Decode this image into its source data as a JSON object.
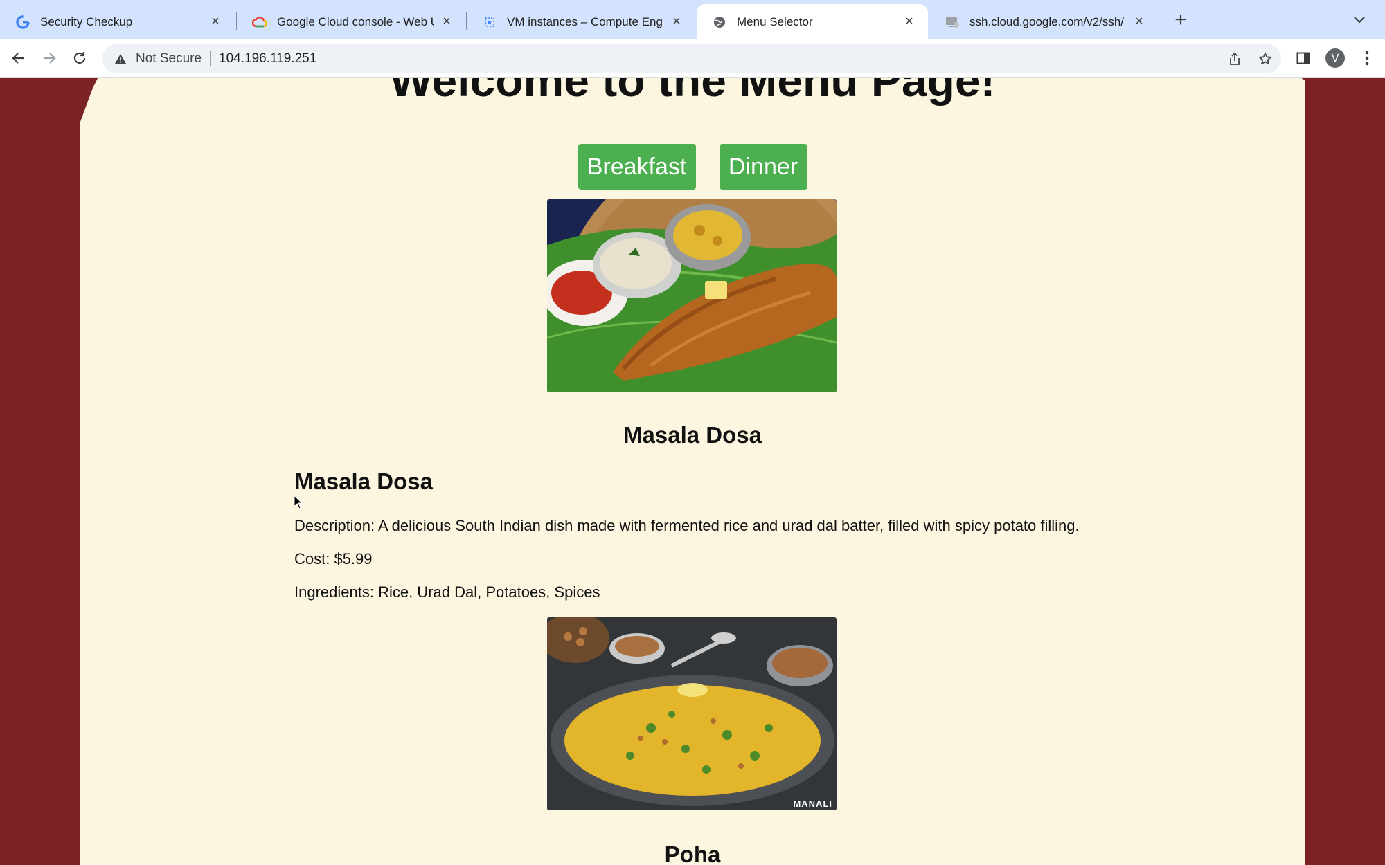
{
  "browser": {
    "tabs": [
      {
        "title": "Security Checkup",
        "icon": "google-g-icon",
        "active": false
      },
      {
        "title": "Google Cloud console - Web U",
        "icon": "google-cloud-icon",
        "active": false
      },
      {
        "title": "VM instances – Compute Engi",
        "icon": "compute-engine-icon",
        "active": false
      },
      {
        "title": "Menu Selector",
        "icon": "globe-icon",
        "active": true
      },
      {
        "title": "ssh.cloud.google.com/v2/ssh/",
        "icon": "terminal-icon",
        "active": false
      }
    ],
    "address": {
      "security_label": "Not Secure",
      "url": "104.196.119.251"
    },
    "profile_initial": "V"
  },
  "page": {
    "title": "Welcome to the Menu Page!",
    "buttons": {
      "breakfast": "Breakfast",
      "dinner": "Dinner"
    },
    "items": [
      {
        "caption": "Masala Dosa",
        "heading": "Masala Dosa",
        "description": "Description: A delicious South Indian dish made with fermented rice and urad dal batter, filled with spicy potato filling.",
        "cost": "Cost: $5.99",
        "ingredients": "Ingredients: Rice, Urad Dal, Potatoes, Spices"
      },
      {
        "caption": "Poha",
        "image_watermark": "MANALI"
      }
    ]
  },
  "colors": {
    "accent_button": "#4caf50",
    "paper": "#fcf6e0",
    "background": "#7b2225"
  }
}
